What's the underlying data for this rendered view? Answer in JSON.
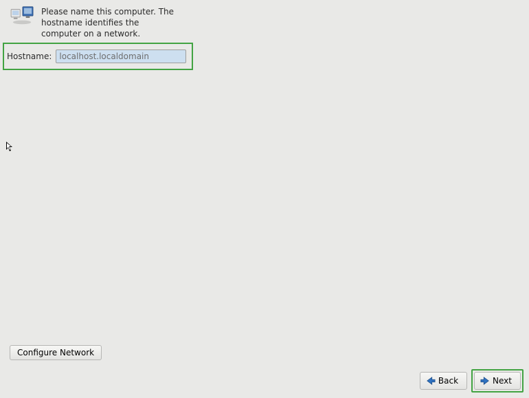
{
  "intro": {
    "text": "Please name this computer.  The hostname identifies the computer on a network."
  },
  "hostname": {
    "label": "Hostname:",
    "value": "localhost.localdomain"
  },
  "buttons": {
    "configure_network": "Configure Network",
    "back": "Back",
    "next": "Next"
  },
  "icons": {
    "network": "network-computers",
    "arrow_left": "←",
    "arrow_right": "→"
  },
  "highlights": {
    "host_row": true,
    "next_button": true
  },
  "colors": {
    "highlight": "#42a342",
    "arrow_blue": "#2f72c1"
  }
}
